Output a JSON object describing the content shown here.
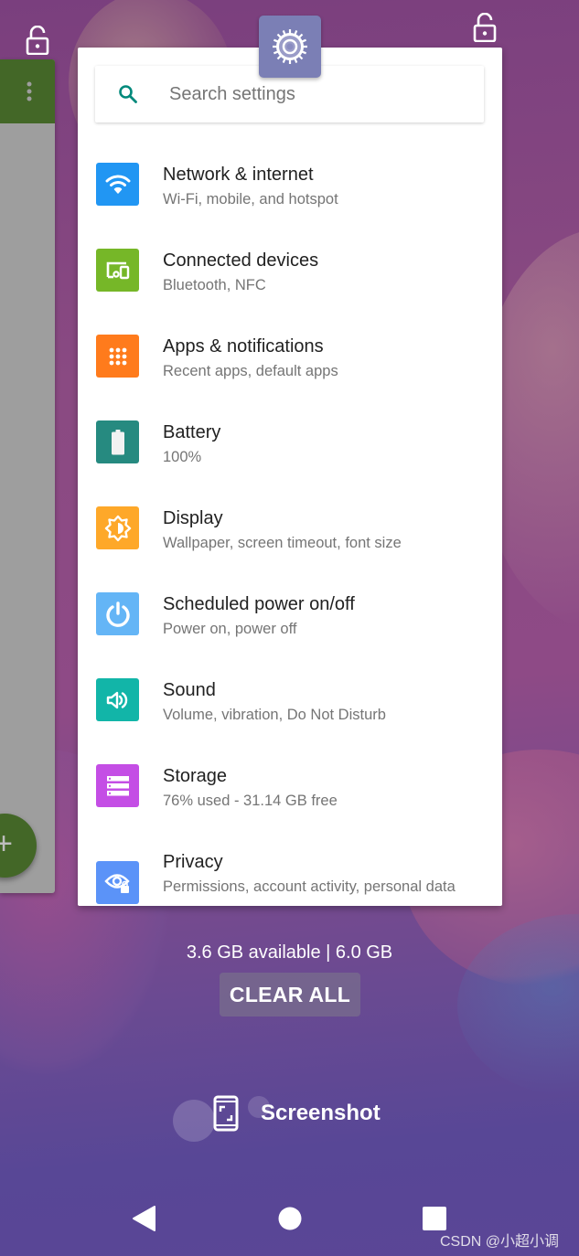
{
  "recents": {
    "app_title": "Settings",
    "search": {
      "placeholder": "Search settings",
      "value": ""
    },
    "settings_items": [
      {
        "title": "Network & internet",
        "subtitle": "Wi-Fi, mobile, and hotspot",
        "icon": "wifi-icon",
        "color": "#2196f3"
      },
      {
        "title": "Connected devices",
        "subtitle": "Bluetooth, NFC",
        "icon": "devices-icon",
        "color": "#76b728"
      },
      {
        "title": "Apps & notifications",
        "subtitle": "Recent apps, default apps",
        "icon": "apps-grid-icon",
        "color": "#ff7b1c"
      },
      {
        "title": "Battery",
        "subtitle": "100%",
        "icon": "battery-icon",
        "color": "#268a80"
      },
      {
        "title": "Display",
        "subtitle": "Wallpaper, screen timeout, font size",
        "icon": "brightness-icon",
        "color": "#fea829"
      },
      {
        "title": "Scheduled power on/off",
        "subtitle": "Power on, power off",
        "icon": "power-icon",
        "color": "#64b5f6"
      },
      {
        "title": "Sound",
        "subtitle": "Volume, vibration, Do Not Disturb",
        "icon": "volume-icon",
        "color": "#12b5a8"
      },
      {
        "title": "Storage",
        "subtitle": "76% used - 31.14 GB free",
        "icon": "storage-icon",
        "color": "#c44ee5"
      },
      {
        "title": "Privacy",
        "subtitle": "Permissions, account activity, personal data",
        "icon": "privacy-eye-icon",
        "color": "#5b93f8"
      }
    ],
    "memory_status": "3.6 GB available | 6.0 GB",
    "clear_all_label": "CLEAR ALL",
    "screenshot_label": "Screenshot"
  },
  "colors": {
    "search_accent": "#00897b",
    "side_app_bar": "#436727",
    "app_icon_bg": "#7b7fb5"
  },
  "navigation": {
    "back": "back-icon",
    "home": "home-icon",
    "recents": "recents-icon"
  },
  "watermark": "CSDN @小超小调"
}
